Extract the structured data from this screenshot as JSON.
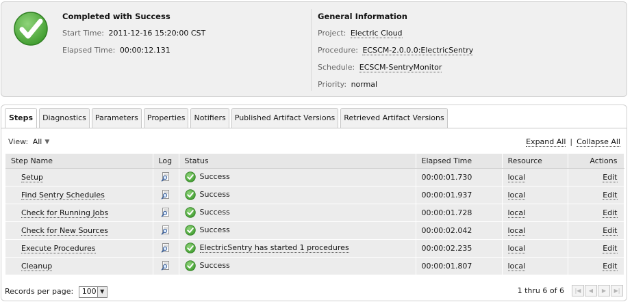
{
  "summary": {
    "status_title": "Completed with Success",
    "start_time_label": "Start Time:",
    "start_time": "2011-12-16 15:20:00 CST",
    "elapsed_label": "Elapsed Time:",
    "elapsed": "00:00:12.131",
    "general_title": "General Information",
    "project_label": "Project:",
    "project": "Electric Cloud",
    "procedure_label": "Procedure:",
    "procedure": "ECSCM-2.0.0.0:ElectricSentry",
    "schedule_label": "Schedule:",
    "schedule": "ECSCM-SentryMonitor",
    "priority_label": "Priority:",
    "priority": "normal",
    "status_color": "#4fa83d"
  },
  "tabs": [
    {
      "label": "Steps"
    },
    {
      "label": "Diagnostics"
    },
    {
      "label": "Parameters"
    },
    {
      "label": "Properties"
    },
    {
      "label": "Notifiers"
    },
    {
      "label": "Published Artifact Versions"
    },
    {
      "label": "Retrieved Artifact Versions"
    }
  ],
  "view": {
    "label": "View:",
    "value": "All"
  },
  "actions": {
    "expand_all": "Expand All",
    "separator": "|",
    "collapse_all": "Collapse All"
  },
  "table": {
    "headers": {
      "step_name": "Step Name",
      "log": "Log",
      "status": "Status",
      "elapsed": "Elapsed Time",
      "resource": "Resource",
      "actions": "Actions"
    },
    "rows": [
      {
        "step": "Setup",
        "status": "Success",
        "elapsed": "00:00:01.730",
        "resource": "local",
        "action": "Edit"
      },
      {
        "step": "Find Sentry Schedules",
        "status": "Success",
        "elapsed": "00:00:01.937",
        "resource": "local",
        "action": "Edit"
      },
      {
        "step": "Check for Running Jobs",
        "status": "Success",
        "elapsed": "00:00:01.728",
        "resource": "local",
        "action": "Edit"
      },
      {
        "step": "Check for New Sources",
        "status": "Success",
        "elapsed": "00:00:02.042",
        "resource": "local",
        "action": "Edit"
      },
      {
        "step": "Execute Procedures",
        "status": "ElectricSentry has started 1 procedures",
        "elapsed": "00:00:02.235",
        "resource": "local",
        "action": "Edit"
      },
      {
        "step": "Cleanup",
        "status": "Success",
        "elapsed": "00:00:01.807",
        "resource": "local",
        "action": "Edit"
      }
    ]
  },
  "footer": {
    "records_label": "Records per page:",
    "records_value": "100",
    "page_count": "1 thru 6 of 6"
  },
  "icons": {
    "status": "checkmark-circle-icon",
    "log": "magnifier-log-icon",
    "pager": [
      "first-page-icon",
      "prev-page-icon",
      "next-page-icon",
      "last-page-icon"
    ]
  }
}
